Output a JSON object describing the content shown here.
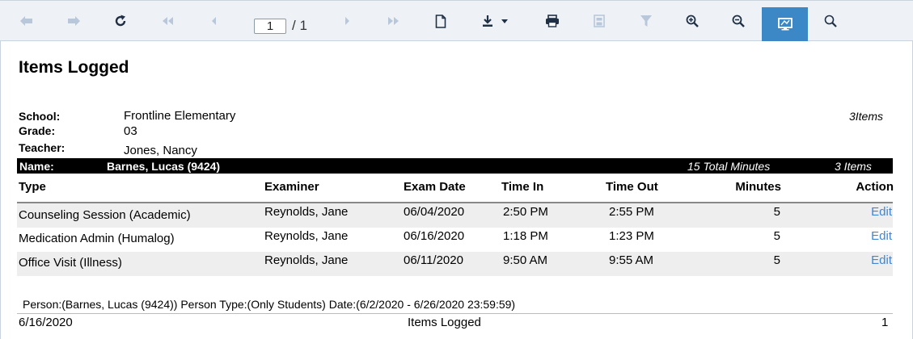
{
  "toolbar": {
    "page_current": "1",
    "page_total": "/ 1",
    "icons": [
      "back-icon",
      "forward-icon",
      "refresh-icon",
      "first-page-icon",
      "prev-page-icon",
      "next-page-icon",
      "last-page-icon",
      "document-icon",
      "download-icon",
      "print-icon",
      "save-icon",
      "filter-icon",
      "zoom-in-icon",
      "zoom-out-icon",
      "screen-view-icon",
      "search-icon"
    ]
  },
  "report": {
    "title": "Items Logged",
    "school_label": "School:",
    "school_value": "Frontline Elementary",
    "grade_label": "Grade:",
    "grade_value": "03",
    "teacher_label": "Teacher:",
    "teacher_value": "Jones, Nancy",
    "items_count": "3Items",
    "name_label": "Name:",
    "name_value": "Barnes, Lucas  (9424)",
    "total_minutes": "15 Total Minutes",
    "total_items": "3  Items"
  },
  "table": {
    "headers": {
      "type": "Type",
      "examiner": "Examiner",
      "exam_date": "Exam Date",
      "time_in": "Time In",
      "time_out": "Time Out",
      "minutes": "Minutes",
      "action": "Action"
    },
    "rows": [
      {
        "type": "Counseling Session (Academic)",
        "examiner": "Reynolds, Jane",
        "exam_date": "06/04/2020",
        "time_in": "2:50 PM",
        "time_out": "2:55 PM",
        "minutes": "5",
        "action": "Edit"
      },
      {
        "type": "Medication Admin (Humalog)",
        "examiner": "Reynolds, Jane",
        "exam_date": "06/16/2020",
        "time_in": "1:18 PM",
        "time_out": "1:23 PM",
        "minutes": "5",
        "action": "Edit"
      },
      {
        "type": "Office Visit (Illness)",
        "examiner": "Reynolds, Jane",
        "exam_date": "06/11/2020",
        "time_in": "9:50 AM",
        "time_out": "9:55 AM",
        "minutes": "5",
        "action": "Edit"
      }
    ]
  },
  "criteria": "Person:(Barnes, Lucas  (9424)) Person Type:(Only Students) Date:(6/2/2020 - 6/26/2020 23:59:59)",
  "footer": {
    "date": "6/16/2020",
    "title": "Items Logged",
    "page": "1"
  },
  "colors": {
    "toolbar_bg": "#eef2f7",
    "active_button": "#3c87c6",
    "link": "#3d86d4",
    "name_bar": "#000000"
  }
}
